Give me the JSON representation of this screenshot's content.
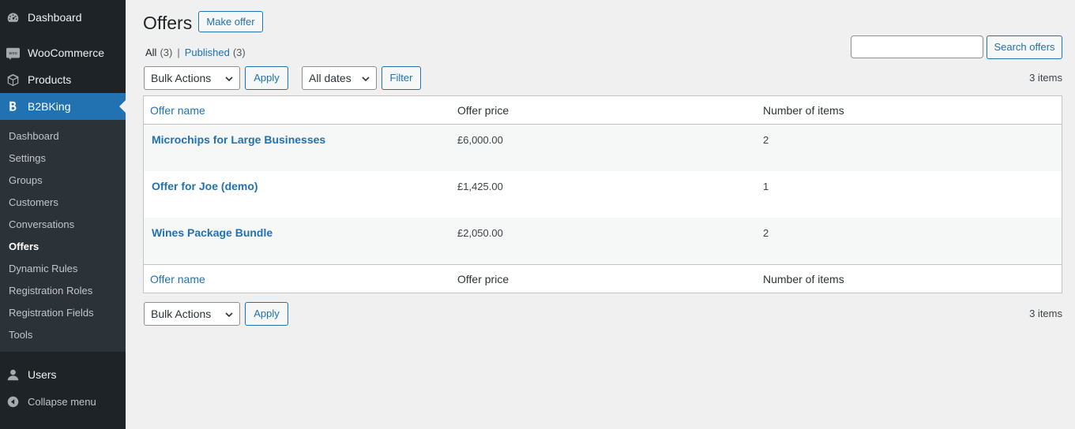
{
  "sidebar": {
    "top_items": [
      {
        "label": "Dashboard",
        "icon": "dashboard-icon"
      },
      {
        "label": "WooCommerce",
        "icon": "woocommerce-icon"
      },
      {
        "label": "Products",
        "icon": "products-icon"
      },
      {
        "label": "B2BKing",
        "icon": "b2bking-icon"
      }
    ],
    "sub_items": [
      {
        "label": "Dashboard"
      },
      {
        "label": "Settings"
      },
      {
        "label": "Groups"
      },
      {
        "label": "Customers"
      },
      {
        "label": "Conversations"
      },
      {
        "label": "Offers"
      },
      {
        "label": "Dynamic Rules"
      },
      {
        "label": "Registration Roles"
      },
      {
        "label": "Registration Fields"
      },
      {
        "label": "Tools"
      }
    ],
    "users_label": "Users",
    "collapse_label": "Collapse menu"
  },
  "page": {
    "title": "Offers",
    "make_offer_label": "Make offer"
  },
  "views": {
    "all_label": "All",
    "all_count": "(3)",
    "separator": "|",
    "published_label": "Published",
    "published_count": "(3)"
  },
  "search": {
    "value": "",
    "button_label": "Search offers"
  },
  "toolbar": {
    "bulk_actions": "Bulk Actions",
    "apply_label": "Apply",
    "dates_value": "All dates",
    "filter_label": "Filter",
    "items_count": "3 items"
  },
  "table": {
    "columns": [
      "Offer name",
      "Offer price",
      "Number of items"
    ],
    "rows": [
      {
        "name": "Microchips for Large Businesses",
        "price": "£6,000.00",
        "items": "2"
      },
      {
        "name": "Offer for Joe (demo)",
        "price": "£1,425.00",
        "items": "1"
      },
      {
        "name": "Wines Package Bundle",
        "price": "£2,050.00",
        "items": "2"
      }
    ]
  },
  "colors": {
    "sidebar_bg": "#1d2327",
    "accent": "#2271b1",
    "link": "#2271b1",
    "page_bg": "#f0f0f1"
  }
}
